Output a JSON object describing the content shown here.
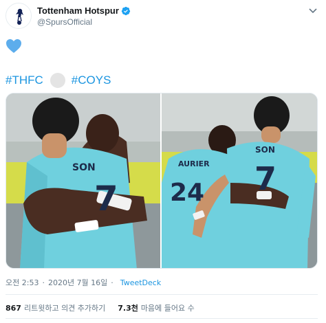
{
  "author": {
    "display_name": "Tottenham Hotspur",
    "handle": "@SpursOfficial",
    "verified": true
  },
  "tweet": {
    "emoji": "blue-heart",
    "hashtag_1": "#THFC",
    "hashtag_2": "#COYS",
    "ball_emoji": "football"
  },
  "media": {
    "photo_left_shirt_text": "SON",
    "photo_left_number": "7",
    "photo_right_shirt_name_left": "AURIER",
    "photo_right_number_left": "24",
    "photo_right_shirt_name_right": "SON",
    "photo_right_number_right": "7"
  },
  "meta": {
    "time": "오전 2:53",
    "separator": "·",
    "date": "2020년 7월 16일",
    "source": "TweetDeck"
  },
  "stats": {
    "retweets_count": "867",
    "retweets_label": "리트윗하고 의견 추가하기",
    "likes_count": "7.3천",
    "likes_label": "마음에 들어요 수"
  },
  "colors": {
    "link": "#1b95e0",
    "kit": "#6fd0de",
    "navy": "#1d2b4a"
  }
}
